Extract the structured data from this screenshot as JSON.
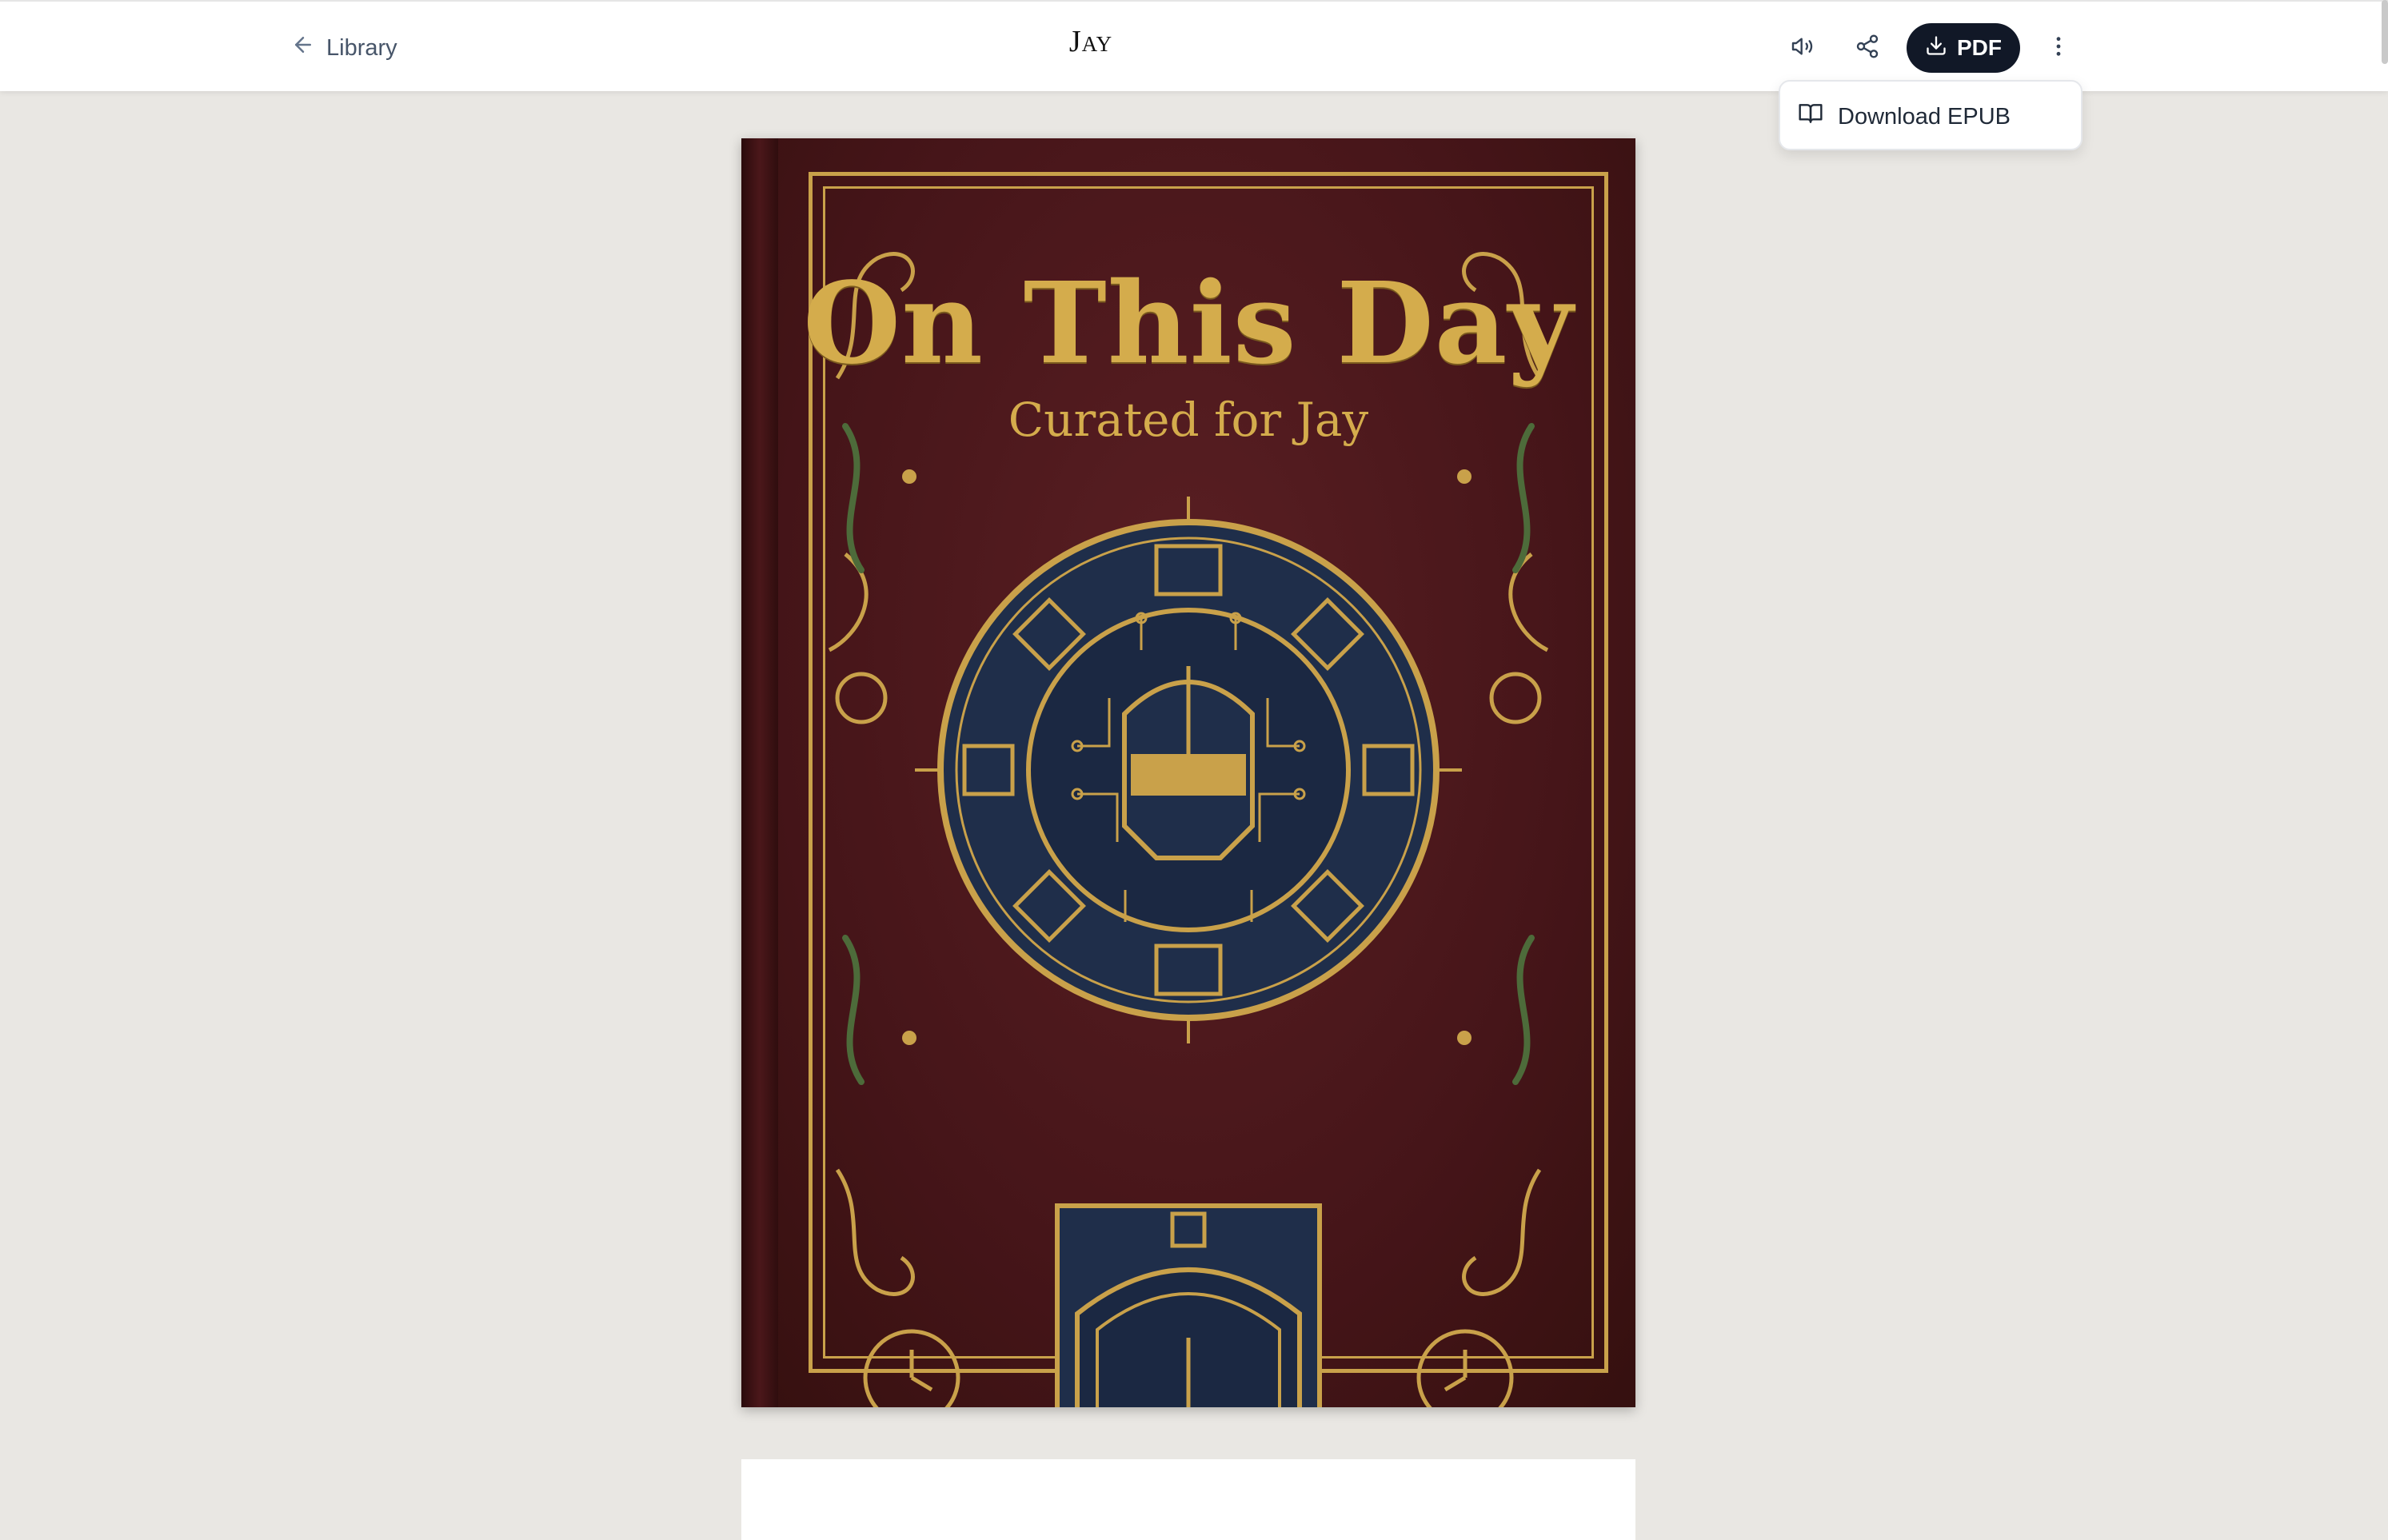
{
  "header": {
    "back_label": "Library",
    "title": "Jay",
    "pdf_label": "PDF"
  },
  "menu": {
    "items": [
      {
        "label": "Download EPUB",
        "icon": "book-open-icon"
      }
    ]
  },
  "cover": {
    "title": "On This Day",
    "subtitle": "Curated for Jay"
  },
  "colors": {
    "accent": "#111827",
    "cover_bg": "#461519",
    "cover_gold": "#d4ac4c",
    "cover_navy": "#1f2e4a",
    "cover_green": "#4d6b3a",
    "page_bg": "#e9e7e3"
  },
  "icons": {
    "back": "arrow-left-icon",
    "audio": "speaker-icon",
    "share": "share-icon",
    "download": "download-icon",
    "more": "more-vertical-icon"
  }
}
